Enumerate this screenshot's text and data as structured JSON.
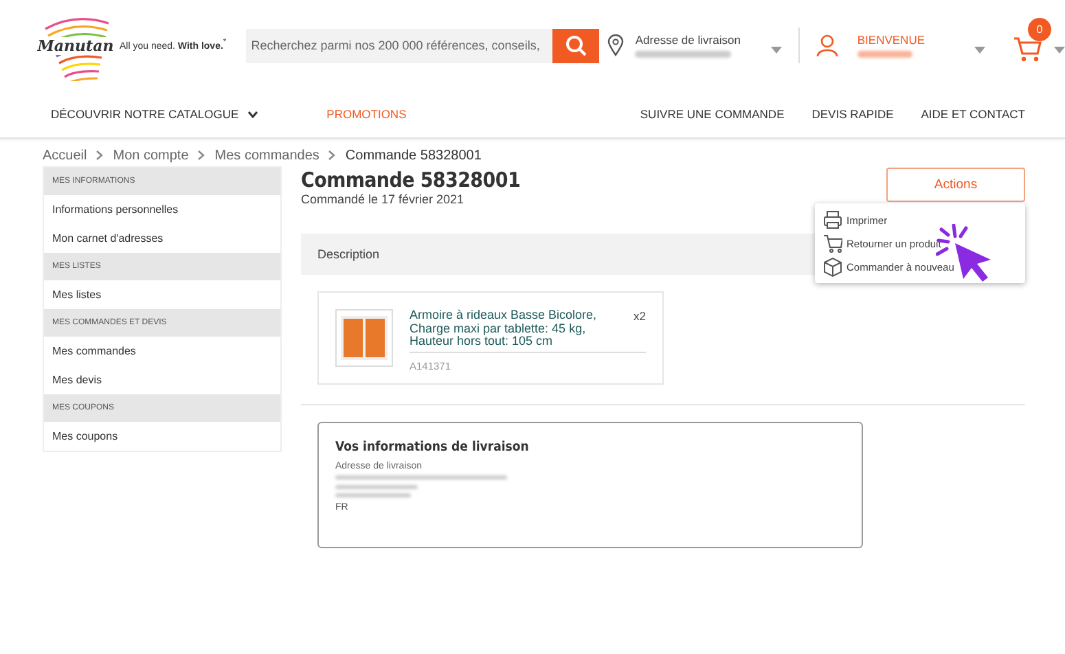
{
  "header": {
    "logo_text": "Manutan",
    "tagline": "All you need. **With love.**$^{*}$",
    "search": {
      "placeholder": "Recherchez parmi nos 200 000 références, conseils,"
    },
    "delivery": {
      "label": "Adresse de livraison"
    },
    "account": {
      "label": "BIENVENUE"
    },
    "cart": {
      "count": "0"
    }
  },
  "nav": {
    "left": [
      {
        "label": "DÉCOUVRIR NOTRE CATALOGUE",
        "kind": "dropdown"
      },
      {
        "label": "PROMOTIONS",
        "kind": "promo"
      }
    ],
    "right": [
      "SUIVRE UNE COMMANDE",
      "DEVIS RAPIDE",
      "AIDE ET CONTACT"
    ]
  },
  "breadcrumb": [
    "Accueil",
    "Mon compte",
    "Mes commandes",
    "Commande 58328001"
  ],
  "sidebar": [
    {
      "heading": "MES INFORMATIONS",
      "items": [
        "Informations personnelles",
        "Mon carnet d'adresses"
      ]
    },
    {
      "heading": "MES LISTES",
      "items": [
        "Mes listes"
      ]
    },
    {
      "heading": "MES COMMANDES ET DEVIS",
      "items": [
        "Mes commandes",
        "Mes devis"
      ]
    },
    {
      "heading": "MES COUPONS",
      "items": [
        "Mes coupons"
      ]
    }
  ],
  "order": {
    "title": "Commande 58328001",
    "date": "Commandé le 17 février 2021",
    "actions_label": "Actions",
    "actions_menu": [
      {
        "label": "Imprimer",
        "kind": "print"
      },
      {
        "label": "Retourner un produit",
        "kind": "cart"
      },
      {
        "label": "Commander à nouveau",
        "kind": "box"
      }
    ],
    "description_heading": "Description",
    "product": {
      "name": "Armoire à rideaux Basse Bicolore, Charge maxi par tablette: 45 kg, Hauteur hors tout: 105 cm",
      "quantity": "x2",
      "reference": "A141371"
    },
    "delivery_info": {
      "title": "Vos informations de livraison",
      "label": "Adresse de livraison",
      "country": "FR"
    }
  }
}
